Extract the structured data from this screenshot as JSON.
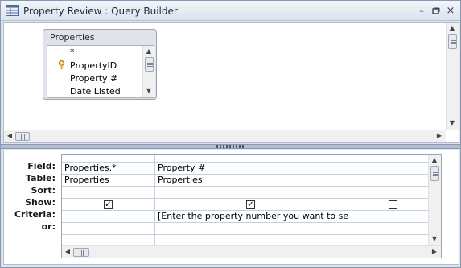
{
  "window": {
    "title": "Property Review : Query Builder"
  },
  "table_box": {
    "title": "Properties",
    "fields": [
      "*",
      "PropertyID",
      "Property #",
      "Date Listed"
    ]
  },
  "grid": {
    "row_labels": [
      "Field:",
      "Table:",
      "Sort:",
      "Show:",
      "Criteria:",
      "or:"
    ],
    "columns": [
      {
        "field": "Properties.*",
        "table": "Properties",
        "sort": "",
        "show": true,
        "criteria": "",
        "or": ""
      },
      {
        "field": "Property #",
        "table": "Properties",
        "sort": "",
        "show": true,
        "criteria": "[Enter the property number you want to see]",
        "or": ""
      },
      {
        "field": "",
        "table": "",
        "sort": "",
        "show": false,
        "criteria": "",
        "or": ""
      }
    ]
  },
  "icons": {
    "app": "query-design-icon",
    "key": "primary-key-icon",
    "minimize": "minimize-icon",
    "restore": "restore-icon",
    "close": "close-icon"
  }
}
